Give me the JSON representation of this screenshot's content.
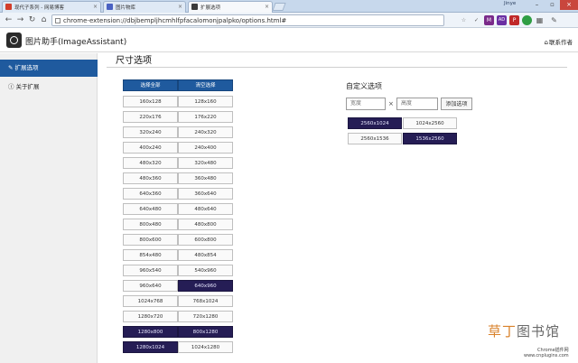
{
  "browser": {
    "tabs": [
      {
        "title": "现代子系列 - 网易博客",
        "color": "#d23d2a"
      },
      {
        "title": "图片物库",
        "color": "#4a62c2"
      },
      {
        "title": "扩展选项",
        "color": "#3b3b3b",
        "active": true
      }
    ],
    "user_label": "Jinye",
    "url": "chrome-extension://dbjbempljhcmhlfpfacalomonjpalpko/options.html#",
    "extensions": [
      {
        "name": "star-icon",
        "glyph": "☆",
        "color": "#777"
      },
      {
        "name": "check-icon",
        "glyph": "✓",
        "color": "#555"
      },
      {
        "name": "ext-m-icon",
        "glyph": "M",
        "color": "#7a2a8a"
      },
      {
        "name": "ext-ad-icon",
        "glyph": "AD",
        "color": "#6b2fa3"
      },
      {
        "name": "ext-pdf-icon",
        "glyph": "P",
        "color": "#c02929"
      },
      {
        "name": "ext-green-icon",
        "glyph": "●",
        "color": "#2f9e44"
      },
      {
        "name": "ext-grid-icon",
        "glyph": "▦",
        "color": "#555"
      },
      {
        "name": "wrench-icon",
        "glyph": "✎",
        "color": "#555"
      }
    ]
  },
  "header": {
    "app_title": "图片助手(ImageAssistant)",
    "feedback": "联系作者"
  },
  "sidebar": {
    "items": [
      {
        "label": "扩展选项",
        "icon": "🔧",
        "active": true
      },
      {
        "label": "关于扩展",
        "icon": "ⓘ",
        "active": false
      }
    ]
  },
  "main": {
    "title": "尺寸选项",
    "select_all": "选择全部",
    "clear_selection": "清空选择",
    "sizes": [
      [
        "160x128",
        "128x160",
        false,
        false
      ],
      [
        "220x176",
        "176x220",
        false,
        false
      ],
      [
        "320x240",
        "240x320",
        false,
        false
      ],
      [
        "400x240",
        "240x400",
        false,
        false
      ],
      [
        "480x320",
        "320x480",
        false,
        false
      ],
      [
        "480x360",
        "360x480",
        false,
        false
      ],
      [
        "640x360",
        "360x640",
        false,
        false
      ],
      [
        "640x480",
        "480x640",
        false,
        false
      ],
      [
        "800x480",
        "480x800",
        false,
        false
      ],
      [
        "800x600",
        "600x800",
        false,
        false
      ],
      [
        "854x480",
        "480x854",
        false,
        false
      ],
      [
        "960x540",
        "540x960",
        false,
        false
      ],
      [
        "960x640",
        "640x960",
        false,
        true
      ],
      [
        "1024x768",
        "768x1024",
        false,
        false
      ],
      [
        "1280x720",
        "720x1280",
        false,
        false
      ],
      [
        "1280x800",
        "800x1280",
        true,
        true
      ],
      [
        "1280x1024",
        "1024x1280",
        true,
        false
      ]
    ]
  },
  "custom": {
    "title": "自定义选项",
    "width_placeholder": "宽度",
    "height_placeholder": "高度",
    "times": "×",
    "add_button": "添加选项",
    "sizes": [
      [
        "2560x1024",
        "1024x2560",
        true,
        false
      ],
      [
        "2560x1536",
        "1536x2560",
        false,
        true
      ]
    ]
  },
  "watermark": {
    "cn_lead": "草丁",
    "cn_rest": "图书馆",
    "en_line1": "Chrome插件网",
    "en_line2": "www.cnplugins.com"
  }
}
